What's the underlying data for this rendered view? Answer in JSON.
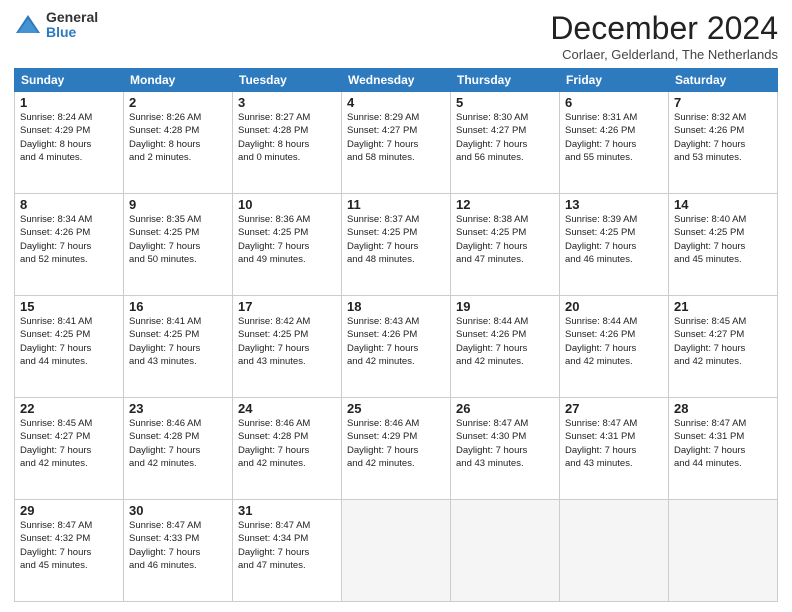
{
  "logo": {
    "general": "General",
    "blue": "Blue"
  },
  "header": {
    "month": "December 2024",
    "location": "Corlaer, Gelderland, The Netherlands"
  },
  "days_of_week": [
    "Sunday",
    "Monday",
    "Tuesday",
    "Wednesday",
    "Thursday",
    "Friday",
    "Saturday"
  ],
  "weeks": [
    [
      {
        "day": "1",
        "info": "Sunrise: 8:24 AM\nSunset: 4:29 PM\nDaylight: 8 hours\nand 4 minutes."
      },
      {
        "day": "2",
        "info": "Sunrise: 8:26 AM\nSunset: 4:28 PM\nDaylight: 8 hours\nand 2 minutes."
      },
      {
        "day": "3",
        "info": "Sunrise: 8:27 AM\nSunset: 4:28 PM\nDaylight: 8 hours\nand 0 minutes."
      },
      {
        "day": "4",
        "info": "Sunrise: 8:29 AM\nSunset: 4:27 PM\nDaylight: 7 hours\nand 58 minutes."
      },
      {
        "day": "5",
        "info": "Sunrise: 8:30 AM\nSunset: 4:27 PM\nDaylight: 7 hours\nand 56 minutes."
      },
      {
        "day": "6",
        "info": "Sunrise: 8:31 AM\nSunset: 4:26 PM\nDaylight: 7 hours\nand 55 minutes."
      },
      {
        "day": "7",
        "info": "Sunrise: 8:32 AM\nSunset: 4:26 PM\nDaylight: 7 hours\nand 53 minutes."
      }
    ],
    [
      {
        "day": "8",
        "info": "Sunrise: 8:34 AM\nSunset: 4:26 PM\nDaylight: 7 hours\nand 52 minutes."
      },
      {
        "day": "9",
        "info": "Sunrise: 8:35 AM\nSunset: 4:25 PM\nDaylight: 7 hours\nand 50 minutes."
      },
      {
        "day": "10",
        "info": "Sunrise: 8:36 AM\nSunset: 4:25 PM\nDaylight: 7 hours\nand 49 minutes."
      },
      {
        "day": "11",
        "info": "Sunrise: 8:37 AM\nSunset: 4:25 PM\nDaylight: 7 hours\nand 48 minutes."
      },
      {
        "day": "12",
        "info": "Sunrise: 8:38 AM\nSunset: 4:25 PM\nDaylight: 7 hours\nand 47 minutes."
      },
      {
        "day": "13",
        "info": "Sunrise: 8:39 AM\nSunset: 4:25 PM\nDaylight: 7 hours\nand 46 minutes."
      },
      {
        "day": "14",
        "info": "Sunrise: 8:40 AM\nSunset: 4:25 PM\nDaylight: 7 hours\nand 45 minutes."
      }
    ],
    [
      {
        "day": "15",
        "info": "Sunrise: 8:41 AM\nSunset: 4:25 PM\nDaylight: 7 hours\nand 44 minutes."
      },
      {
        "day": "16",
        "info": "Sunrise: 8:41 AM\nSunset: 4:25 PM\nDaylight: 7 hours\nand 43 minutes."
      },
      {
        "day": "17",
        "info": "Sunrise: 8:42 AM\nSunset: 4:25 PM\nDaylight: 7 hours\nand 43 minutes."
      },
      {
        "day": "18",
        "info": "Sunrise: 8:43 AM\nSunset: 4:26 PM\nDaylight: 7 hours\nand 42 minutes."
      },
      {
        "day": "19",
        "info": "Sunrise: 8:44 AM\nSunset: 4:26 PM\nDaylight: 7 hours\nand 42 minutes."
      },
      {
        "day": "20",
        "info": "Sunrise: 8:44 AM\nSunset: 4:26 PM\nDaylight: 7 hours\nand 42 minutes."
      },
      {
        "day": "21",
        "info": "Sunrise: 8:45 AM\nSunset: 4:27 PM\nDaylight: 7 hours\nand 42 minutes."
      }
    ],
    [
      {
        "day": "22",
        "info": "Sunrise: 8:45 AM\nSunset: 4:27 PM\nDaylight: 7 hours\nand 42 minutes."
      },
      {
        "day": "23",
        "info": "Sunrise: 8:46 AM\nSunset: 4:28 PM\nDaylight: 7 hours\nand 42 minutes."
      },
      {
        "day": "24",
        "info": "Sunrise: 8:46 AM\nSunset: 4:28 PM\nDaylight: 7 hours\nand 42 minutes."
      },
      {
        "day": "25",
        "info": "Sunrise: 8:46 AM\nSunset: 4:29 PM\nDaylight: 7 hours\nand 42 minutes."
      },
      {
        "day": "26",
        "info": "Sunrise: 8:47 AM\nSunset: 4:30 PM\nDaylight: 7 hours\nand 43 minutes."
      },
      {
        "day": "27",
        "info": "Sunrise: 8:47 AM\nSunset: 4:31 PM\nDaylight: 7 hours\nand 43 minutes."
      },
      {
        "day": "28",
        "info": "Sunrise: 8:47 AM\nSunset: 4:31 PM\nDaylight: 7 hours\nand 44 minutes."
      }
    ],
    [
      {
        "day": "29",
        "info": "Sunrise: 8:47 AM\nSunset: 4:32 PM\nDaylight: 7 hours\nand 45 minutes."
      },
      {
        "day": "30",
        "info": "Sunrise: 8:47 AM\nSunset: 4:33 PM\nDaylight: 7 hours\nand 46 minutes."
      },
      {
        "day": "31",
        "info": "Sunrise: 8:47 AM\nSunset: 4:34 PM\nDaylight: 7 hours\nand 47 minutes."
      },
      {
        "day": "",
        "info": ""
      },
      {
        "day": "",
        "info": ""
      },
      {
        "day": "",
        "info": ""
      },
      {
        "day": "",
        "info": ""
      }
    ]
  ]
}
